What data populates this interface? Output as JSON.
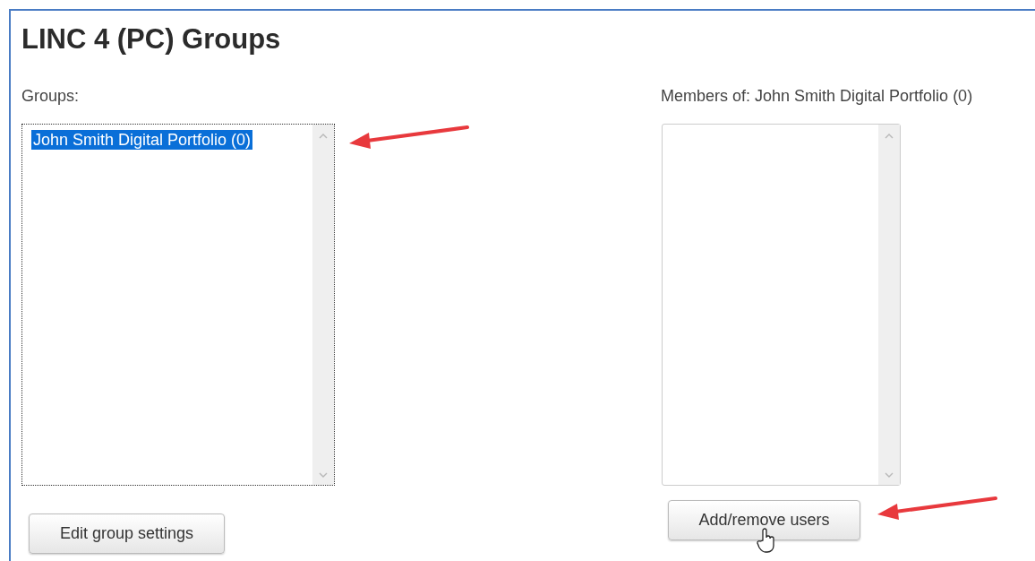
{
  "title": "LINC 4 (PC) Groups",
  "groups": {
    "label": "Groups:",
    "items": [
      {
        "text": "John Smith Digital Portfolio (0)",
        "selected": true
      }
    ],
    "button": "Edit group settings"
  },
  "members": {
    "label": "Members of: John Smith Digital Portfolio (0)",
    "button": "Add/remove users"
  }
}
